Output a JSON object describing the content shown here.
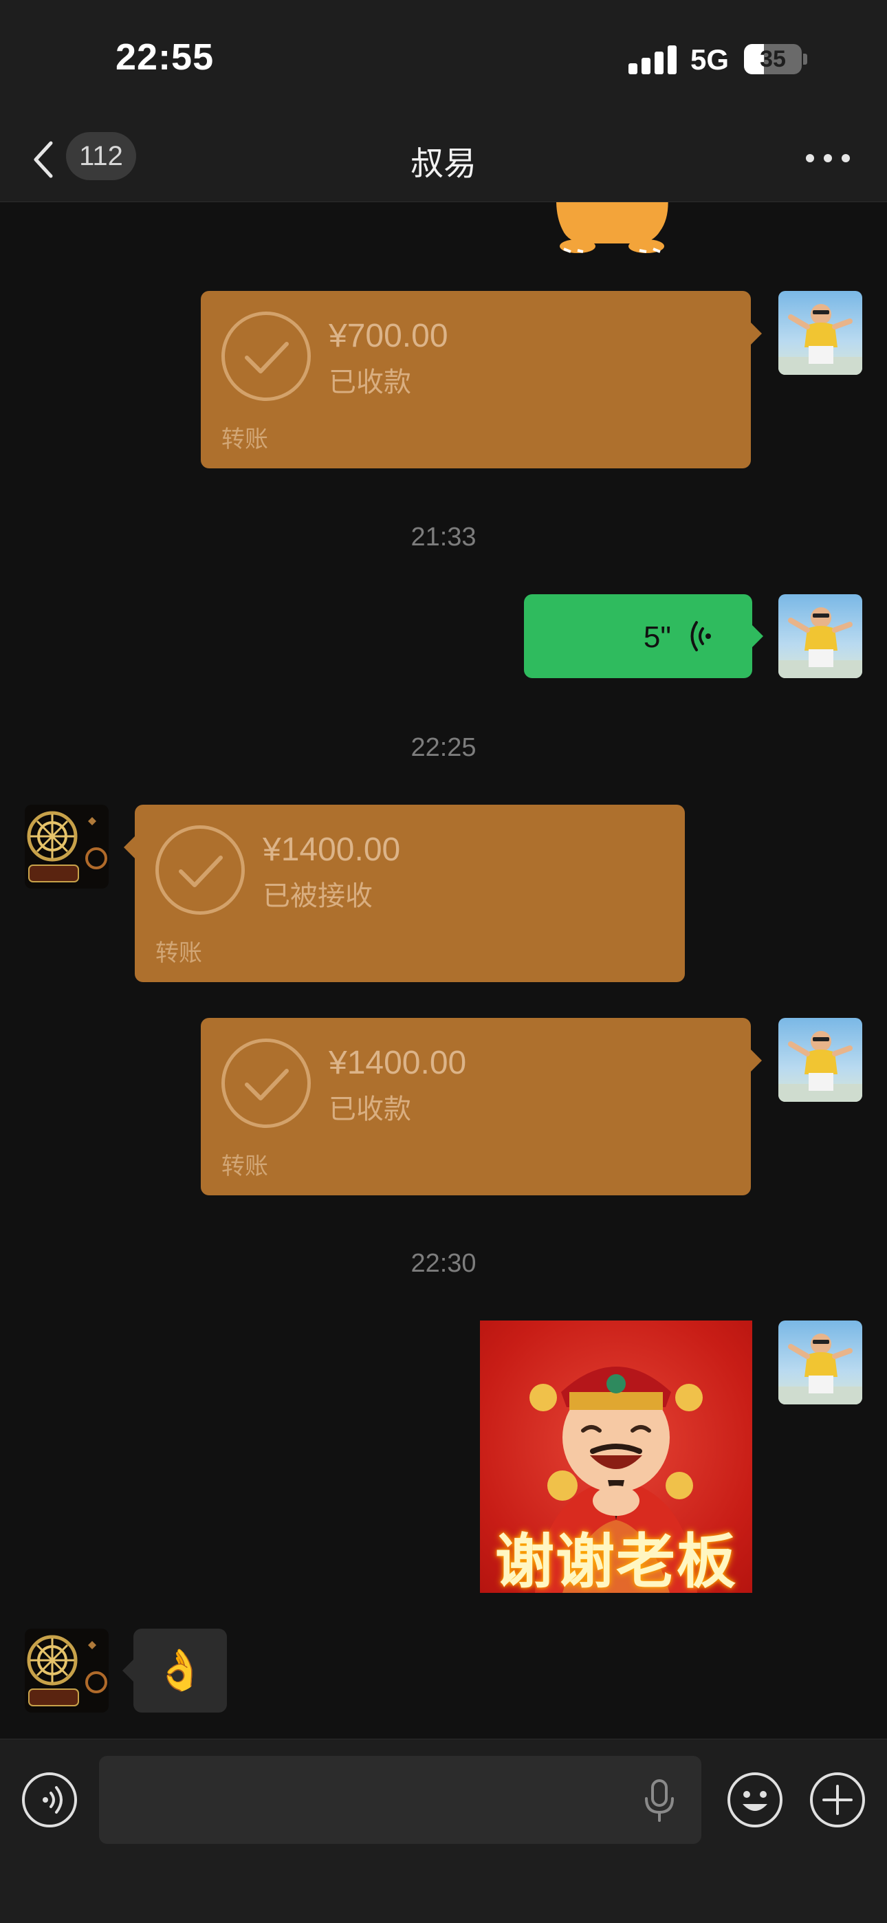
{
  "status_bar": {
    "time": "22:55",
    "network": "5G",
    "battery_percent": 35,
    "battery_label": "35"
  },
  "nav": {
    "unread_count": "112",
    "title": "叔易",
    "back_icon": "chevron-left-icon",
    "more_icon": "more-dots-icon"
  },
  "messages": {
    "transfer_1": {
      "amount": "¥700.00",
      "status": "已收款",
      "label": "转账",
      "direction": "outgoing"
    },
    "time_1": "21:33",
    "voice_1": {
      "duration": "5\"",
      "direction": "outgoing"
    },
    "time_2": "22:25",
    "transfer_2": {
      "amount": "¥1400.00",
      "status": "已被接收",
      "label": "转账",
      "direction": "incoming"
    },
    "transfer_3": {
      "amount": "¥1400.00",
      "status": "已收款",
      "label": "转账",
      "direction": "outgoing"
    },
    "time_3": "22:30",
    "sticker_1": {
      "text": "谢谢老板",
      "direction": "outgoing"
    },
    "emoji_1": {
      "emoji": "👌",
      "direction": "incoming"
    }
  },
  "input_bar": {
    "voice_toggle_icon": "voice-mode-icon",
    "mic_icon": "microphone-icon",
    "emoji_icon": "smiley-icon",
    "plus_icon": "plus-icon",
    "value": ""
  },
  "colors": {
    "background": "#111111",
    "bar": "#1e1e1e",
    "transfer_bubble": "#ae702d",
    "voice_bubble": "#2fbb5e",
    "sticker_red": "#c81d16"
  }
}
